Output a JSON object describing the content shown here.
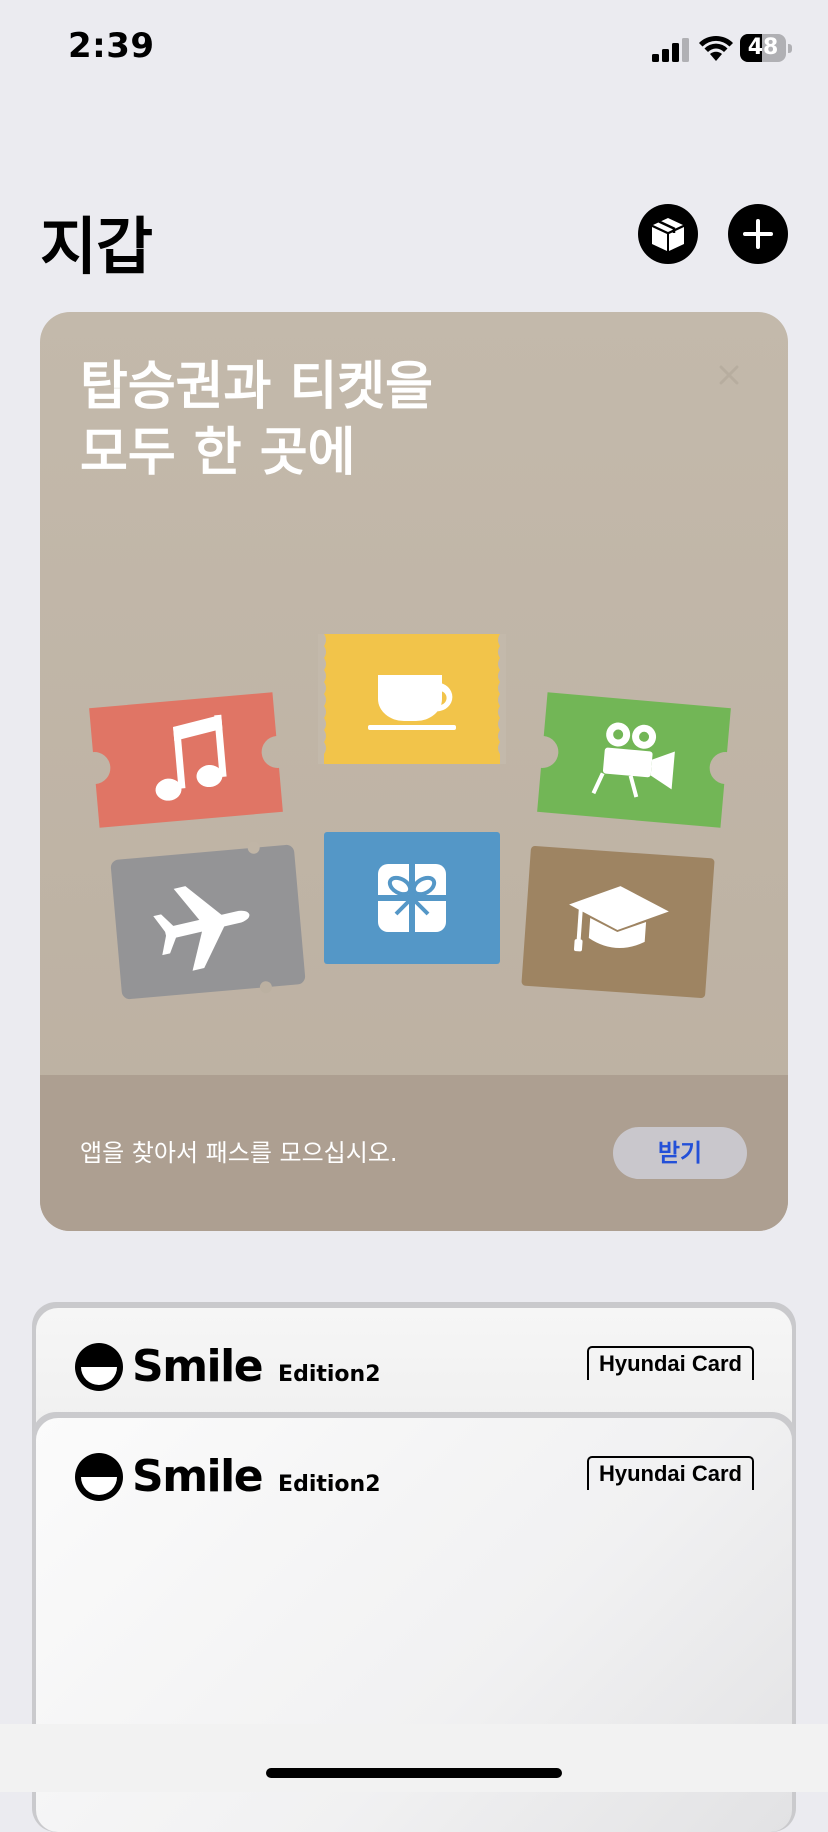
{
  "status_bar": {
    "time": "2:39",
    "battery": "48",
    "battery_level": 0.48
  },
  "header": {
    "title": "지갑"
  },
  "promo": {
    "title": "탑승권과 티켓을\n모두 한 곳에",
    "footer_text": "앱을 찾아서 패스를 모으십시오.",
    "get_button": "받기",
    "ticket_icons": [
      "music-icon",
      "coffee-cup-icon",
      "movie-camera-icon",
      "airplane-icon",
      "gift-icon",
      "graduation-cap-icon"
    ]
  },
  "cards": [
    {
      "brand": "Smile",
      "edition": "Edition2",
      "issuer": "Hyundai Card"
    },
    {
      "brand": "Smile",
      "edition": "Edition2",
      "issuer": "Hyundai Card"
    }
  ],
  "colors": {
    "background": "#ebebf0",
    "promo_bg": "#c3b9ab",
    "promo_footer": "#ad9f91",
    "ticket_red": "#e07565",
    "ticket_yellow": "#f2c44a",
    "ticket_green": "#72b656",
    "ticket_gray": "#949496",
    "ticket_blue": "#5497c7",
    "ticket_brown": "#9e8462",
    "get_button_text": "#2350d8"
  }
}
